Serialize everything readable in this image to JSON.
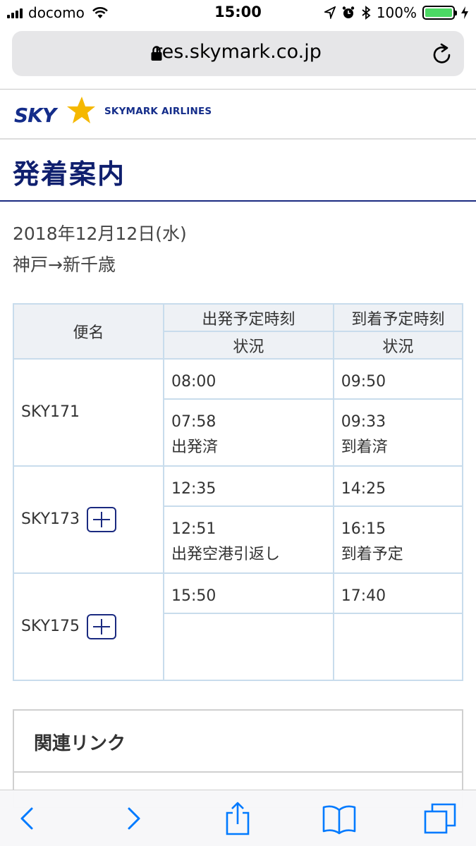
{
  "status_bar": {
    "carrier": "docomo",
    "time": "15:00",
    "battery_percent": "100%"
  },
  "browser": {
    "url": "res.skymark.co.jp"
  },
  "site": {
    "logo_sky": "SKY",
    "logo_text": "SKYMARK AIRLINES",
    "page_title": "発着案内",
    "date": "2018年12月12日(水)",
    "route": "神戸→新千歳"
  },
  "table": {
    "header_flight": "便名",
    "header_departure": "出発予定時刻",
    "header_arrival": "到着予定時刻",
    "header_status_dep": "状況",
    "header_status_arr": "状況",
    "rows": [
      {
        "flight": "SKY171",
        "dep_time": "08:00",
        "arr_time": "09:50",
        "dep_actual": "07:58",
        "dep_status": "出発済",
        "arr_actual": "09:33",
        "arr_status": "到着済"
      },
      {
        "flight": "SKY173",
        "dep_time": "12:35",
        "arr_time": "14:25",
        "dep_actual": "12:51",
        "dep_status": "出発空港引返し",
        "arr_actual": "16:15",
        "arr_status": "到着予定"
      },
      {
        "flight": "SKY175",
        "dep_time": "15:50",
        "arr_time": "17:40",
        "dep_actual": "",
        "dep_status": "",
        "arr_actual": "",
        "arr_status": ""
      }
    ]
  },
  "related": {
    "title": "関連リンク"
  },
  "colors": {
    "brand_navy": "#0f1f6e",
    "logo_star": "#f5b800",
    "table_border": "#c8dcec",
    "toolbar_blue": "#007aff",
    "battery_green": "#4cd964"
  }
}
